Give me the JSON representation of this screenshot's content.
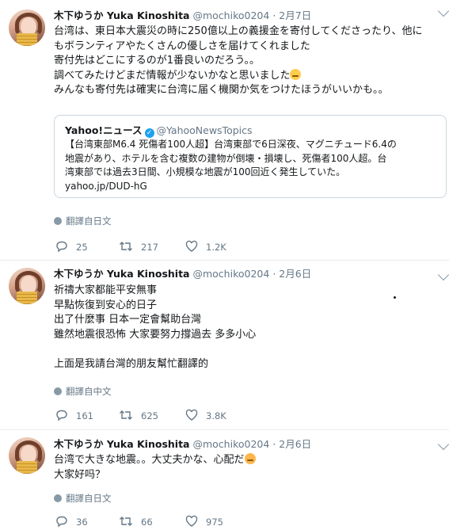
{
  "tweets": [
    {
      "name": "木下ゆうか Yuka Kinoshita",
      "handle": "@mochiko0204",
      "date": "2月7日",
      "lines": [
        "台湾は、東日本大震災の時に250億以上の義援金を寄付してくださったり、他に",
        "もボランティアやたくさんの優しさを届けてくれました",
        "寄付先はどこにするのが1番良いのだろう。。",
        "調べてみたけどまだ情報が少ないかなと思いました",
        "みんなも寄付先は確実に台湾に届く機関か気をつけたほうがいいかも。。"
      ],
      "quote": {
        "name": "Yahoo!ニュース",
        "handle": "@YahooNewsTopics",
        "lines": [
          "【台湾東部M6.4 死傷者100人超】台湾東部で6日深夜、マグニチュード6.4の",
          "地震があり、ホテルを含む複数の建物が倒壊・損壊し、死傷者100人超。台",
          "湾東部では過去3日間、小規模な地震が100回近く発生していた。",
          "yahoo.jp/DUD-hG"
        ]
      },
      "translate": "翻譯自日文",
      "replies": "25",
      "retweets": "217",
      "likes": "1.2K"
    },
    {
      "name": "木下ゆうか Yuka Kinoshita",
      "handle": "@mochiko0204",
      "date": "2月6日",
      "lines": [
        "祈禱大家都能平安無事",
        "早點恢復到安心的日子",
        "出了什麼事 日本一定會幫助台灣",
        "雖然地震很恐怖 大家要努力撐過去 多多小心",
        "",
        "上面是我請台灣的朋友幫忙翻譯的"
      ],
      "translate": "翻譯自中文",
      "replies": "161",
      "retweets": "625",
      "likes": "3.8K"
    },
    {
      "name": "木下ゆうか Yuka Kinoshita",
      "handle": "@mochiko0204",
      "date": "2月6日",
      "lines": [
        "台湾で大きな地震。。大丈夫かな、心配だ",
        "大家好吗？"
      ],
      "translate": "翻譯自日文",
      "replies": "36",
      "retweets": "66",
      "likes": "975"
    }
  ],
  "colors": {
    "text": "#14171a",
    "muted": "#657786",
    "link": "#1b95e0",
    "divider": "#e6ecf0"
  },
  "icons": [
    "reply-icon",
    "retweet-icon",
    "like-icon",
    "globe-icon",
    "chevron-down-icon",
    "verified-icon",
    "worried-face-emoji",
    "persevering-face-emoji"
  ]
}
